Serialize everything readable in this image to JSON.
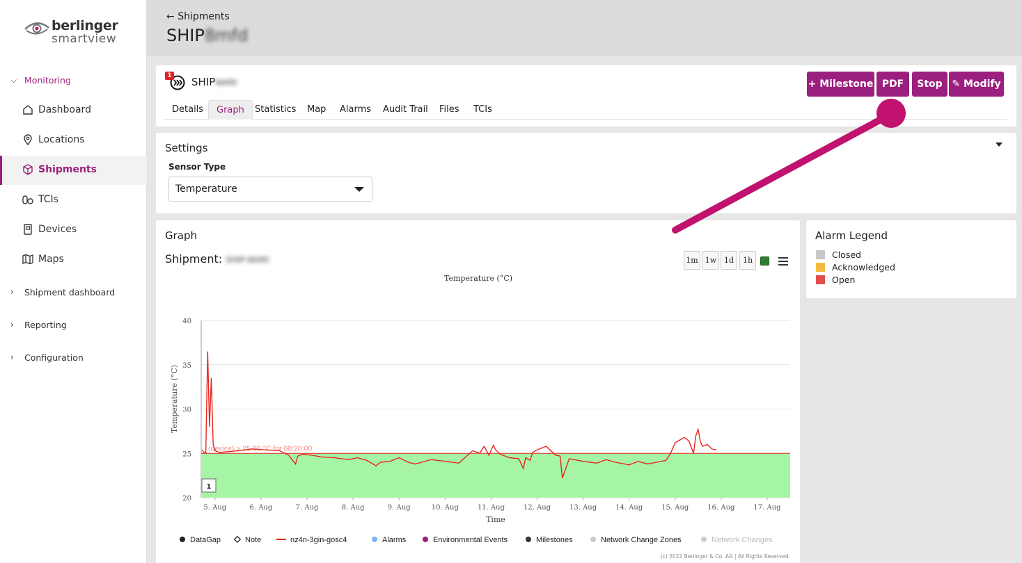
{
  "brand": {
    "line1": "berlinger",
    "line2": "smartview"
  },
  "sidebar": {
    "monitoring_label": "Monitoring",
    "items": [
      {
        "label": "Dashboard",
        "icon": "home-icon"
      },
      {
        "label": "Locations",
        "icon": "location-pin-icon"
      },
      {
        "label": "Shipments",
        "icon": "box-icon"
      },
      {
        "label": "TCIs",
        "icon": "pills-icon"
      },
      {
        "label": "Devices",
        "icon": "device-icon"
      },
      {
        "label": "Maps",
        "icon": "map-icon"
      }
    ],
    "groups": [
      {
        "label": "Shipment dashboard"
      },
      {
        "label": "Reporting"
      },
      {
        "label": "Configuration"
      }
    ]
  },
  "header": {
    "back_label": "Shipments",
    "title_prefix": "SHIP",
    "title_id_blurred": "8mfd"
  },
  "shipment": {
    "badge": "1",
    "name_prefix": "SHIP",
    "name_id_blurred": "WARI",
    "tabs": [
      "Details",
      "Graph",
      "Statistics",
      "Map",
      "Alarms",
      "Audit Trail",
      "Files",
      "TCIs"
    ],
    "active_tab": "Graph",
    "buttons": {
      "milestone": "+ Milestone",
      "pdf": "PDF",
      "stop": "Stop",
      "modify": "Modify"
    }
  },
  "settings": {
    "title": "Settings",
    "sensor_type_label": "Sensor Type",
    "sensor_type_value": "Temperature"
  },
  "graph": {
    "title": "Graph",
    "shipment_label": "Shipment:",
    "shipment_id_blurred": "SHIP-WARI",
    "range_buttons": [
      "1m",
      "1w",
      "1d",
      "1h"
    ],
    "footer_credit": "(c) 2022 Berlinger & Co. AG | All Rights Reserved.",
    "milestone_marker": "1",
    "legend": [
      {
        "label": "DataGap",
        "symbol": "dot",
        "color": "#222222"
      },
      {
        "label": "Note",
        "symbol": "diamond",
        "color": "#222222"
      },
      {
        "label": "nz4n-3gin-gosc4",
        "symbol": "line",
        "color": "#e8261c"
      },
      {
        "label": "Alarms",
        "symbol": "dot",
        "color": "#7cb5ec"
      },
      {
        "label": "Environmental Events",
        "symbol": "dot",
        "color": "#9b1f7e"
      },
      {
        "label": "Milestones",
        "symbol": "dot",
        "color": "#333333"
      },
      {
        "label": "Network Change Zones",
        "symbol": "dot",
        "color": "#cccccc"
      },
      {
        "label": "Network Changes",
        "symbol": "dot",
        "color": "#cccccc",
        "disabled": true
      }
    ]
  },
  "chart_data": {
    "type": "line",
    "title": "Temperature (°C)",
    "xlabel": "Time",
    "ylabel": "Temperature (°C)",
    "ylim": [
      20,
      40
    ],
    "yticks": [
      20,
      25,
      30,
      35,
      40
    ],
    "xticks": [
      "5. Aug",
      "6. Aug",
      "7. Aug",
      "8. Aug",
      "9. Aug",
      "10. Aug",
      "11. Aug",
      "12. Aug",
      "13. Aug",
      "14. Aug",
      "15. Aug",
      "16. Aug",
      "17. Aug"
    ],
    "xlim_days": [
      4.7,
      17.5
    ],
    "threshold": {
      "value": 25,
      "label": "(device) > 25.00 °C for 00:20:00",
      "fill": "#a6f5a6",
      "line": "#e8261c"
    },
    "series": [
      {
        "name": "nz4n-3gin-gosc4",
        "color": "#e8261c",
        "x": [
          4.72,
          4.76,
          4.8,
          4.84,
          4.88,
          4.92,
          4.96,
          5.0,
          5.1,
          5.3,
          5.5,
          5.8,
          6.1,
          6.4,
          6.6,
          6.75,
          6.8,
          6.9,
          7.1,
          7.3,
          7.6,
          7.9,
          8.1,
          8.3,
          8.5,
          8.6,
          8.8,
          9.0,
          9.2,
          9.35,
          9.5,
          9.7,
          10.0,
          10.3,
          10.6,
          10.75,
          10.85,
          10.95,
          11.05,
          11.1,
          11.2,
          11.4,
          11.6,
          11.7,
          11.75,
          11.85,
          11.9,
          12.0,
          12.1,
          12.2,
          12.4,
          12.5,
          12.55,
          12.7,
          13.0,
          13.3,
          13.5,
          13.7,
          14.0,
          14.2,
          14.4,
          14.6,
          14.8,
          14.9,
          15.0,
          15.1,
          15.2,
          15.3,
          15.4,
          15.45,
          15.5,
          15.55,
          15.6,
          15.7,
          15.8,
          15.9
        ],
        "y": [
          25.4,
          25.1,
          25.0,
          36.5,
          28.0,
          33.5,
          26.0,
          25.3,
          25.1,
          25.2,
          25.3,
          25.5,
          25.4,
          25.3,
          24.8,
          23.8,
          24.7,
          24.9,
          24.8,
          24.6,
          24.5,
          24.3,
          24.5,
          24.2,
          23.6,
          24.0,
          24.1,
          24.5,
          24.0,
          23.8,
          24.0,
          24.3,
          24.1,
          23.9,
          25.3,
          25.0,
          25.8,
          24.8,
          25.9,
          25.4,
          24.9,
          24.5,
          24.4,
          23.3,
          24.5,
          24.2,
          25.1,
          25.4,
          25.6,
          25.8,
          24.8,
          24.7,
          22.2,
          24.4,
          24.1,
          23.9,
          24.3,
          24.0,
          23.7,
          24.1,
          23.8,
          24.0,
          24.2,
          25.0,
          26.2,
          26.5,
          26.8,
          26.4,
          25.0,
          27.0,
          27.7,
          26.3,
          25.8,
          26.0,
          25.5,
          25.4
        ]
      }
    ]
  },
  "alarm_legend": {
    "title": "Alarm Legend",
    "items": [
      {
        "label": "Closed",
        "color": "#c8c8c8"
      },
      {
        "label": "Acknowledged",
        "color": "#f5b942"
      },
      {
        "label": "Open",
        "color": "#e05050"
      }
    ]
  }
}
